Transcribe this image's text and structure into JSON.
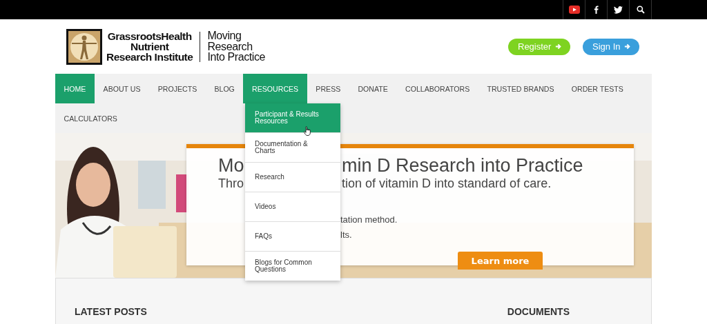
{
  "top_bar": {
    "icons": [
      {
        "kind": "youtube"
      },
      {
        "kind": "facebook"
      },
      {
        "kind": "twitter"
      },
      {
        "kind": "search"
      }
    ]
  },
  "header": {
    "logo": {
      "name_lines": [
        "GrassrootsHealth",
        "Nutrient",
        "Research Institute"
      ],
      "tagline_lines": [
        "Moving",
        "Research",
        "Into Practice"
      ]
    },
    "buttons": [
      {
        "label": "Register",
        "color": "#7ed321"
      },
      {
        "label": "Sign In",
        "color": "#3a9fdc"
      }
    ]
  },
  "nav": {
    "items": [
      {
        "label": "HOME",
        "selected": true
      },
      {
        "label": "ABOUT US",
        "selected": false
      },
      {
        "label": "PROJECTS",
        "selected": false
      },
      {
        "label": "BLOG",
        "selected": false
      },
      {
        "label": "RESOURCES",
        "selected": true
      },
      {
        "label": "PRESS",
        "selected": false
      },
      {
        "label": "DONATE",
        "selected": false
      },
      {
        "label": "COLLABORATORS",
        "selected": false
      },
      {
        "label": "TRUSTED BRANDS",
        "selected": false
      },
      {
        "label": "ORDER TESTS",
        "selected": false
      },
      {
        "label": "CALCULATORS",
        "selected": false
      }
    ]
  },
  "dropdown": {
    "items": [
      {
        "label": "Participant & Results Resources",
        "selected": true
      },
      {
        "label": "Documentation & Charts",
        "selected": false
      },
      {
        "label": "Research",
        "selected": false
      },
      {
        "label": "Videos",
        "selected": false
      },
      {
        "label": "FAQs",
        "selected": false
      },
      {
        "label": "Blogs for Common Questions",
        "selected": false
      }
    ]
  },
  "hero": {
    "banner": {
      "title": [
        "Mo",
        "min D Research into Practice"
      ],
      "subtitle": [
        "Thro",
        "tion of vitamin D into standard of care."
      ],
      "lines": [
        "tation method.",
        "lts."
      ],
      "button": "Learn more"
    }
  },
  "content": {
    "headings": [
      "LATEST POSTS",
      "DOCUMENTS"
    ]
  }
}
